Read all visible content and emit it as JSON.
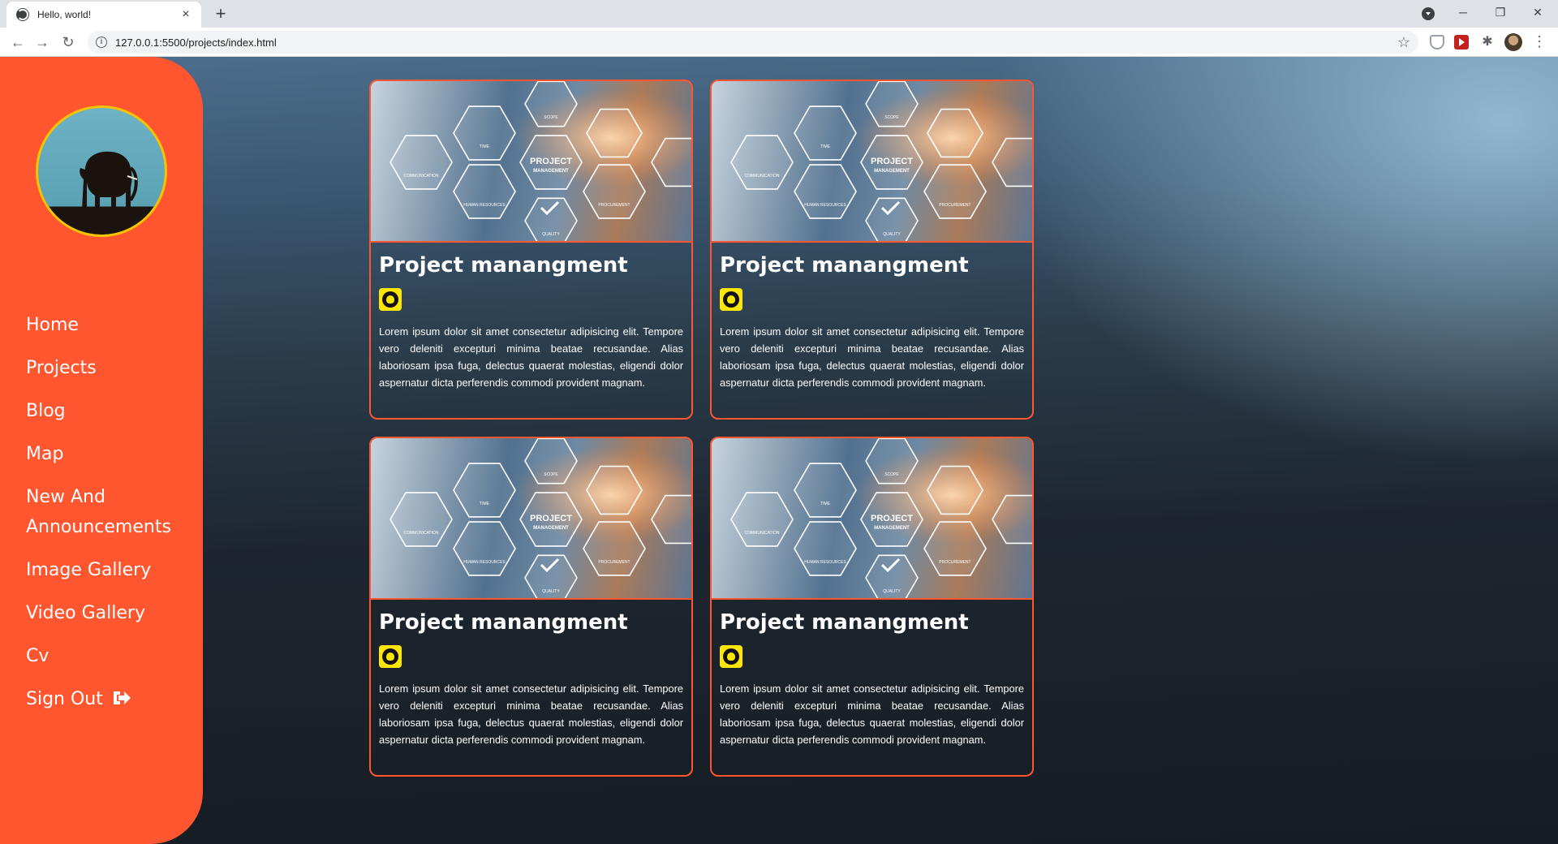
{
  "browser": {
    "tab_title": "Hello, world!",
    "tab_close": "×",
    "new_tab": "+",
    "url": "127.0.0.1:5500/projects/index.html",
    "window_minimize": "─",
    "window_restore": "❐",
    "window_close": "✕",
    "back": "←",
    "forward": "→",
    "reload": "↻",
    "star": "☆",
    "menu": "⋮"
  },
  "sidebar": {
    "nav": [
      {
        "label": "Home"
      },
      {
        "label": "Projects"
      },
      {
        "label": "Blog"
      },
      {
        "label": "Map"
      },
      {
        "label": "New And Announcements"
      },
      {
        "label": "Image Gallery"
      },
      {
        "label": "Video Gallery"
      },
      {
        "label": "Cv"
      },
      {
        "label": "Sign Out"
      }
    ]
  },
  "projects": [
    {
      "title": "Project manangment",
      "description": "Lorem ipsum dolor sit amet consectetur adipisicing elit. Tempore vero deleniti excepturi minima beatae recusandae. Alias laboriosam ipsa fuga, delectus quaerat molestias, eligendi dolor aspernatur dicta perferendis commodi provident magnam.",
      "image_labels": [
        "SCOPE",
        "TIME",
        "COMMUNICATION",
        "PROJECT",
        "MANAGEMENT",
        "HUMAN RESOURCES",
        "QUALITY",
        "PROCUREMENT"
      ]
    },
    {
      "title": "Project manangment",
      "description": "Lorem ipsum dolor sit amet consectetur adipisicing elit. Tempore vero deleniti excepturi minima beatae recusandae. Alias laboriosam ipsa fuga, delectus quaerat molestias, eligendi dolor aspernatur dicta perferendis commodi provident magnam.",
      "image_labels": [
        "SCOPE",
        "TIME",
        "COMMUNICATION",
        "PROJECT",
        "MANAGEMENT",
        "HUMAN RESOURCES",
        "QUALITY",
        "PROCUREMENT"
      ]
    },
    {
      "title": "Project manangment",
      "description": "Lorem ipsum dolor sit amet consectetur adipisicing elit. Tempore vero deleniti excepturi minima beatae recusandae. Alias laboriosam ipsa fuga, delectus quaerat molestias, eligendi dolor aspernatur dicta perferendis commodi provident magnam.",
      "image_labels": [
        "SCOPE",
        "TIME",
        "COMMUNICATION",
        "PROJECT",
        "MANAGEMENT",
        "HUMAN RESOURCES",
        "QUALITY",
        "PROCUREMENT"
      ]
    },
    {
      "title": "Project manangment",
      "description": "Lorem ipsum dolor sit amet consectetur adipisicing elit. Tempore vero deleniti excepturi minima beatae recusandae. Alias laboriosam ipsa fuga, delectus quaerat molestias, eligendi dolor aspernatur dicta perferendis commodi provident magnam.",
      "image_labels": [
        "SCOPE",
        "TIME",
        "COMMUNICATION",
        "PROJECT",
        "MANAGEMENT",
        "HUMAN RESOURCES",
        "QUALITY",
        "PROCUREMENT"
      ]
    }
  ],
  "colors": {
    "sidebar": "#ff5630",
    "card_border": "#ff5630",
    "github_badge": "#ffe600",
    "logo_ring": "#f5c400"
  },
  "icons": {
    "github": "github-icon",
    "signout": "sign-out-icon"
  }
}
